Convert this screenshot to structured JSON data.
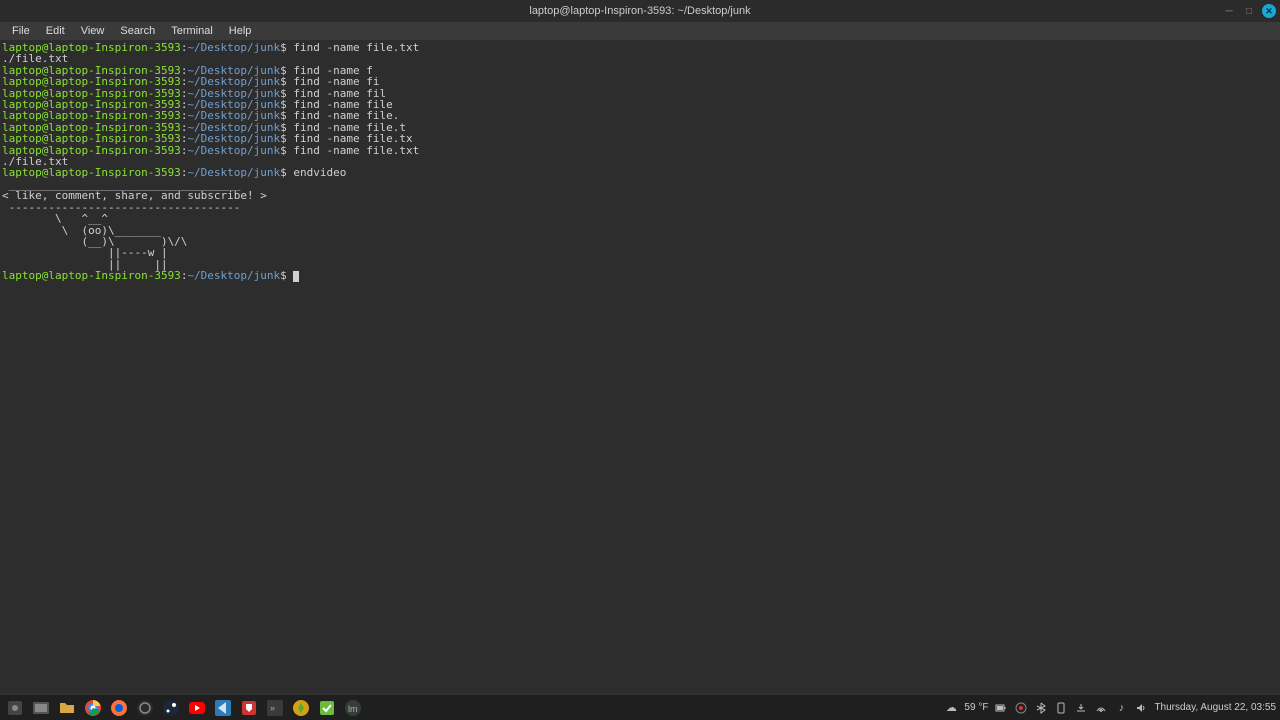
{
  "window": {
    "title": "laptop@laptop-Inspiron-3593: ~/Desktop/junk"
  },
  "menu": {
    "file": "File",
    "edit": "Edit",
    "view": "View",
    "search": "Search",
    "terminal": "Terminal",
    "help": "Help"
  },
  "prompt": {
    "user_host": "laptop@laptop-Inspiron-3593",
    "colon": ":",
    "tilde": "~",
    "path": "/Desktop/junk",
    "dollar": "$"
  },
  "lines": [
    {
      "cmd": " find -name file.txt"
    },
    {
      "out": "./file.txt"
    },
    {
      "cmd": " find -name f"
    },
    {
      "cmd": " find -name fi"
    },
    {
      "cmd": " find -name fil"
    },
    {
      "cmd": " find -name file"
    },
    {
      "cmd": " find -name file."
    },
    {
      "cmd": " find -name file.t"
    },
    {
      "cmd": " find -name file.tx"
    },
    {
      "cmd": " find -name file.txt"
    },
    {
      "out": "./file.txt"
    },
    {
      "cmd": " endvideo"
    }
  ],
  "cowsay": " ___________________________________ \n< like, comment, share, and subscribe! >\n ----------------------------------- \n        \\   ^__^\n         \\  (oo)\\_______\n            (__)\\       )\\/\\\n                ||----w |\n                ||     ||",
  "taskbar": {
    "temp": "59 °F",
    "clock": "Thursday, August 22, 03:55"
  }
}
